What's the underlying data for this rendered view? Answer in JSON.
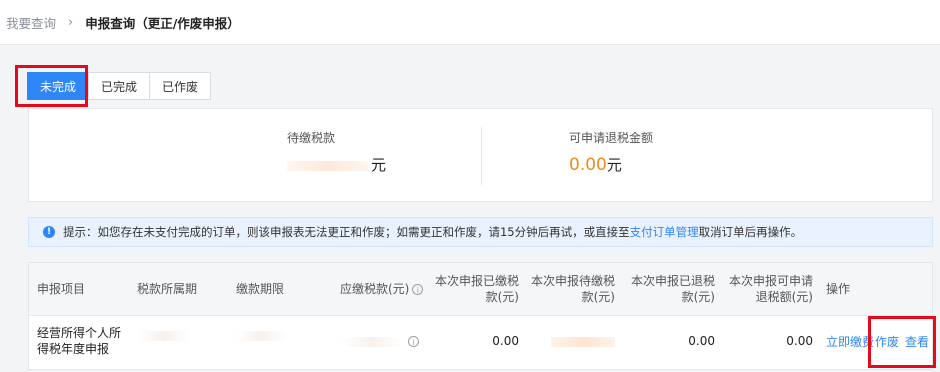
{
  "breadcrumb": {
    "parent": "我要查询",
    "separator": "›",
    "current": "申报查询（更正/作废申报）"
  },
  "tabs": [
    {
      "label": "未完成",
      "active": true
    },
    {
      "label": "已完成",
      "active": false
    },
    {
      "label": "已作废",
      "active": false
    }
  ],
  "summary": {
    "pending_label": "待缴税款",
    "pending_unit": "元",
    "refund_label": "可申请退税金额",
    "refund_value": "0.00",
    "refund_unit": "元"
  },
  "notice": {
    "icon": "info-icon",
    "text_before": "提示：如您存在未支付完成的订单，则该申报表无法更正和作废；如需更正和作废，请15分钟后再试，或直接至 ",
    "link": "支付订单管理",
    "text_after": " 取消订单后再操作。"
  },
  "table": {
    "headers": {
      "item": "申报项目",
      "period": "税款所属期",
      "deadline": "缴款期限",
      "due": "应缴税款(元)",
      "paid_l1": "本次申报已缴税",
      "paid_l2": "款(元)",
      "unpaid_l1": "本次申报待缴税",
      "unpaid_l2": "款(元)",
      "refunded_l1": "本次申报已退税",
      "refunded_l2": "款(元)",
      "refundable_l1": "本次申报可申请",
      "refundable_l2": "退税额(元)",
      "actions": "操作"
    },
    "row": {
      "item_l1": "经营所得个人所",
      "item_l2": "得税年度申报",
      "paid": "0.00",
      "refunded": "0.00",
      "refundable": "0.00",
      "action_pay": "立即缴费",
      "action_void": "作废",
      "action_view": "查看"
    }
  },
  "colors": {
    "accent": "#2f86f6",
    "refund": "#f08a1c",
    "highlight": "#e5091b"
  }
}
